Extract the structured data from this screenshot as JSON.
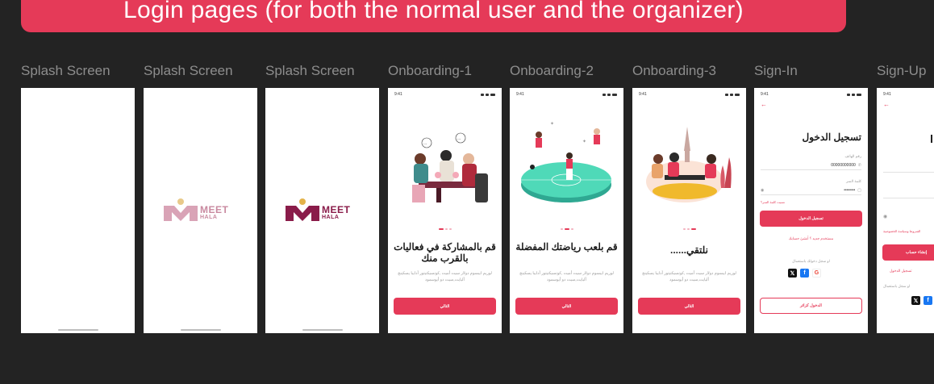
{
  "banner": {
    "title": "Login pages (for both the normal user and the organizer)"
  },
  "screens": {
    "splash1": {
      "caption": "Splash Screen"
    },
    "splash2": {
      "caption": "Splash Screen",
      "logo_word": "MEET",
      "logo_sub": "HALA"
    },
    "splash3": {
      "caption": "Splash Screen",
      "logo_word": "MEET",
      "logo_sub": "HALA"
    },
    "onboarding1": {
      "caption": "Onboarding-1",
      "time": "9:41",
      "title": "قم بالمشاركة في فعاليات بالقرب منك",
      "description": "لوريم ايبسوم دولار سيت أميت ,كونسيكتيتور أدايبا يسكينج أليايت,سيت دو أيوسمود",
      "button": "التالي"
    },
    "onboarding2": {
      "caption": "Onboarding-2",
      "time": "9:41",
      "title": "قم بلعب رياضتك المفضلة",
      "description": "لوريم ايبسوم دولار سيت أميت ,كونسيكتيتور أدايبا يسكينج أليايت,سيت دو أيوسمود",
      "button": "التالي"
    },
    "onboarding3": {
      "caption": "Onboarding-3",
      "time": "9:41",
      "title": "نلتقي......",
      "description": "لوريم ايبسوم دولار سيت أميت ,كونسيكتيتور أدايبا يسكينج أليايت,سيت دو أيوسمود",
      "button": "التالي"
    },
    "signin": {
      "caption": "Sign-In",
      "time": "9:41",
      "title": "تسجيل الدخول",
      "phone_label": "رقم الهاتف",
      "phone_value": "00000000000",
      "password_label": "كلمة السر",
      "password_value": "••••••••",
      "forgot": "نسيت كلمة السر؟",
      "login_button": "تسجيل الدخول",
      "new_user": "مستخدم جديد ؟ أنشئ حسابك",
      "or_login_with": "او سجل دخولك باستعمال",
      "guest_button": "الدخول كزائر"
    },
    "signup": {
      "caption": "Sign-Up",
      "time": "9:41",
      "button": "إنشاء حساب",
      "terms": "الشروط وسياسة الخصوصية",
      "have_account": "تسجيل الدخول",
      "or_signup_with": "او سجل باستعمال"
    }
  },
  "colors": {
    "accent": "#e53a58",
    "background": "#232323",
    "logo_light": "#c98aa0",
    "logo_dark": "#8a1c4a"
  }
}
